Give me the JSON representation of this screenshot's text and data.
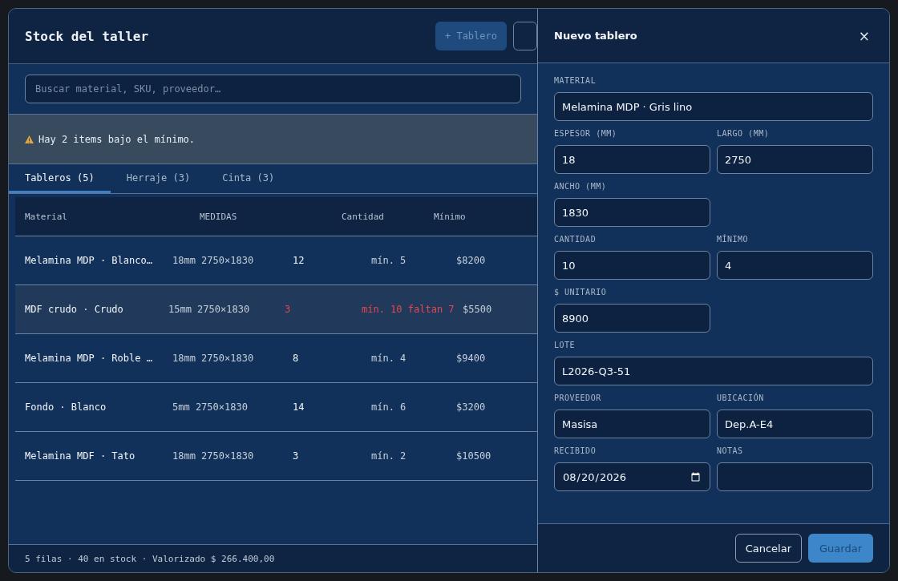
{
  "stock": {
    "title": "Stock del taller",
    "add_button": {
      "label": "+ Tablero",
      "disabled": true
    },
    "search": {
      "placeholder": "Buscar material, SKU, proveedor…"
    },
    "alert": {
      "text": "Hay 2 items bajo el mínimo."
    },
    "tabs": [
      {
        "label": "Tableros (5)",
        "selected": true
      },
      {
        "label": "Herraje (3)",
        "selected": false
      },
      {
        "label": "Cinta (3)",
        "selected": false
      }
    ],
    "table": {
      "columns": [
        "Material",
        "MEDIDAS",
        "Cantidad",
        "Mínimo"
      ],
      "rows": [
        {
          "material": "Melamina MDP · Blanco…",
          "medidas": "18mm 2750×1830",
          "cantidad": "12",
          "minimo": "mín. 5",
          "precio": "$8200",
          "low": false
        },
        {
          "material": "MDF crudo · Crudo",
          "medidas": "15mm 2750×1830",
          "cantidad": "3",
          "minimo": "mín. 10 faltan 7",
          "precio": "$5500",
          "low": true
        },
        {
          "material": "Melamina MDP · Roble …",
          "medidas": "18mm 2750×1830",
          "cantidad": "8",
          "minimo": "mín. 4",
          "precio": "$9400",
          "low": false
        },
        {
          "material": "Fondo · Blanco",
          "medidas": "5mm 2750×1830",
          "cantidad": "14",
          "minimo": "mín. 6",
          "precio": "$3200",
          "low": false
        },
        {
          "material": "Melamina MDF · Tato",
          "medidas": "18mm 2750×1830",
          "cantidad": "3",
          "minimo": "mín. 2",
          "precio": "$10500",
          "low": false
        }
      ]
    },
    "footer": "5 filas · 40 en stock · Valorizado $ 266.400,00"
  },
  "drawer": {
    "title": "Nuevo tablero",
    "close": "×",
    "form_rows": [
      {
        "fields": [
          {
            "label": "MATERIAL",
            "value": "Melamina MDP · Gris lino",
            "kind": "text",
            "wide": true
          }
        ]
      },
      {
        "fields": [
          {
            "label": "ESPESOR (MM)",
            "value": "18",
            "kind": "text",
            "wide": false
          },
          {
            "label": "LARGO (MM)",
            "value": "2750",
            "kind": "text",
            "wide": false
          }
        ]
      },
      {
        "fields": [
          {
            "label": "ANCHO (MM)",
            "value": "1830",
            "kind": "text",
            "wide": false
          }
        ]
      },
      {
        "fields": [
          {
            "label": "CANTIDAD",
            "value": "10",
            "kind": "text",
            "wide": false
          },
          {
            "label": "MÍNIMO",
            "value": "4",
            "kind": "text",
            "wide": false
          }
        ]
      },
      {
        "fields": [
          {
            "label": "$ UNITARIO",
            "value": "8900",
            "kind": "text",
            "wide": false
          }
        ]
      },
      {
        "fields": [
          {
            "label": "LOTE",
            "value": "L2026-Q3-51",
            "kind": "text",
            "wide": true
          }
        ]
      },
      {
        "fields": [
          {
            "label": "PROVEEDOR",
            "value": "Masisa",
            "kind": "text",
            "wide": false
          },
          {
            "label": "UBICACIÓN",
            "value": "Dep.A-E4",
            "kind": "text",
            "wide": false
          }
        ]
      },
      {
        "fields": [
          {
            "label": "RECIBIDO",
            "value": "08/20/2026",
            "kind": "date",
            "wide": false
          },
          {
            "label": "NOTAS",
            "kind": "text",
            "wide": false
          }
        ]
      }
    ],
    "buttons": [
      {
        "label": "Cancelar",
        "kind": "secondary"
      },
      {
        "label": "Guardar",
        "kind": "primary"
      }
    ]
  }
}
